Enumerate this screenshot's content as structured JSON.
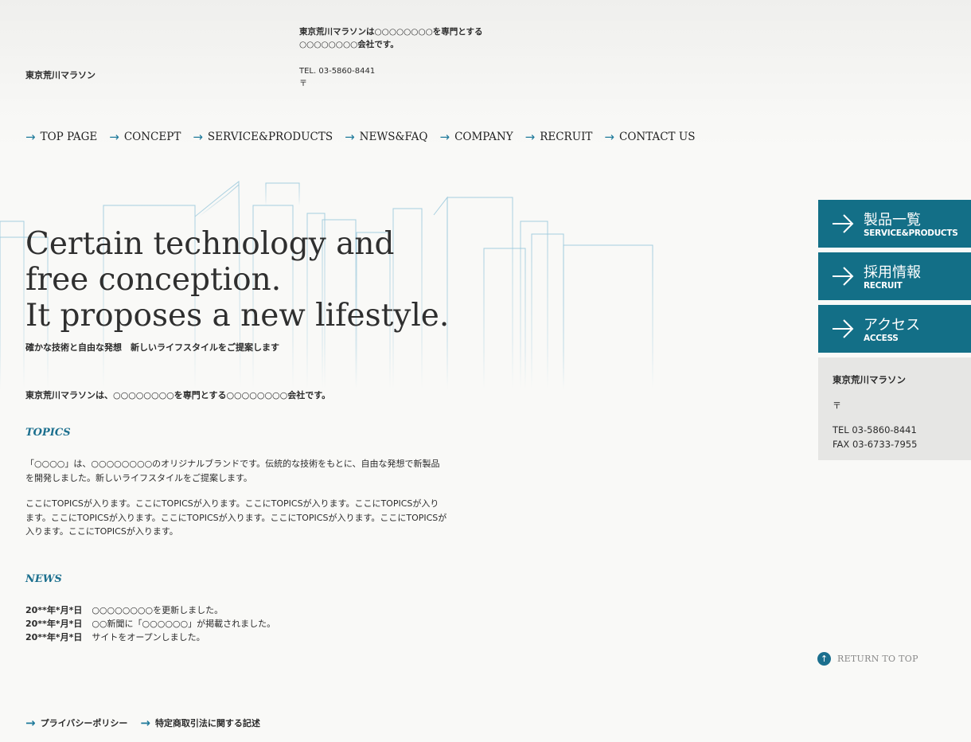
{
  "header": {
    "site_name": "東京荒川マラソン",
    "tagline_line1": "東京荒川マラソンは○○○○○○○○を専門とする",
    "tagline_line2": "○○○○○○○○会社です。",
    "tel": "TEL. 03-5860-8441",
    "postal": "〒"
  },
  "nav": {
    "items": [
      {
        "label": "TOP PAGE"
      },
      {
        "label": "CONCEPT"
      },
      {
        "label": "SERVICE&PRODUCTS"
      },
      {
        "label": "NEWS&FAQ"
      },
      {
        "label": "COMPANY"
      },
      {
        "label": "RECRUIT"
      },
      {
        "label": "CONTACT US"
      }
    ]
  },
  "hero": {
    "line1": "Certain technology and",
    "line2": "free conception.",
    "line3": "It proposes a new lifestyle.",
    "subtitle": "確かな技術と自由な発想　新しいライフスタイルをご提案します"
  },
  "intro": "東京荒川マラソンは、○○○○○○○○を専門とする○○○○○○○○会社です。",
  "topics": {
    "title": "TOPICS",
    "para1": "「○○○○」は、○○○○○○○○のオリジナルブランドです。伝統的な技術をもとに、自由な発想で新製品を開発しました。新しいライフスタイルをご提案します。",
    "para2": "ここにTOPICSが入ります。ここにTOPICSが入ります。ここにTOPICSが入ります。ここにTOPICSが入ります。ここにTOPICSが入ります。ここにTOPICSが入ります。ここにTOPICSが入ります。ここにTOPICSが入ります。ここにTOPICSが入ります。"
  },
  "news": {
    "title": "NEWS",
    "items": [
      {
        "date": "20**年*月*日",
        "text": "○○○○○○○○を更新しました。"
      },
      {
        "date": "20**年*月*日",
        "text": "○○新聞に「○○○○○○」が掲載されました。"
      },
      {
        "date": "20**年*月*日",
        "text": "サイトをオープンしました。"
      }
    ]
  },
  "side_buttons": [
    {
      "jp": "製品一覧",
      "en": "SERVICE&PRODUCTS"
    },
    {
      "jp": "採用情報",
      "en": "RECRUIT"
    },
    {
      "jp": "アクセス",
      "en": "ACCESS"
    }
  ],
  "info": {
    "name": "東京荒川マラソン",
    "postal": "〒",
    "tel": "TEL 03-5860-8441",
    "fax": "FAX 03-6733-7955"
  },
  "return_top": {
    "label": "RETURN TO TOP",
    "icon": "arrow-up-icon"
  },
  "footer": {
    "links": [
      {
        "label": "プライバシーポリシー"
      },
      {
        "label": "特定商取引法に関する記述"
      }
    ]
  },
  "colors": {
    "accent": "#136f87",
    "background": "#f9f9f7",
    "info_box": "#e6e6e4"
  }
}
